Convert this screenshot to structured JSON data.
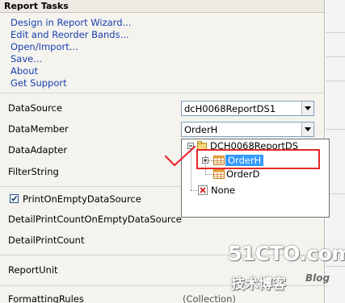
{
  "panel": {
    "title": "Report Tasks",
    "links": [
      "Design in Report Wizard...",
      "Edit and Reorder Bands...",
      "Open/Import...",
      "Save...",
      "About",
      "Get Support"
    ],
    "properties": {
      "datasource_label": "DataSource",
      "datasource_value": "dcH0068ReportDS1",
      "datamember_label": "DataMember",
      "datamember_value": "OrderH",
      "dataadapter_label": "DataAdapter",
      "filterstring_label": "FilterString",
      "printonempty_label": "PrintOnEmptyDataSource",
      "printonempty_checked": true,
      "detailcountempty_label": "DetailPrintCountOnEmptyDataSource",
      "detailcount_label": "DetailPrintCount",
      "reportunit_label": "ReportUnit",
      "formattingrules_label": "FormattingRules",
      "formattingrules_value": "(Collection)"
    }
  },
  "dropdown_tree": {
    "root": "DCH0068ReportDS",
    "children": [
      "OrderH",
      "OrderD"
    ],
    "selected": "OrderH",
    "none_label": "None"
  },
  "annotation": {
    "highlight_color": "#e8262b"
  },
  "watermark": {
    "site": "51CTO.com",
    "cn": "技术博客",
    "blog": "Blog"
  }
}
